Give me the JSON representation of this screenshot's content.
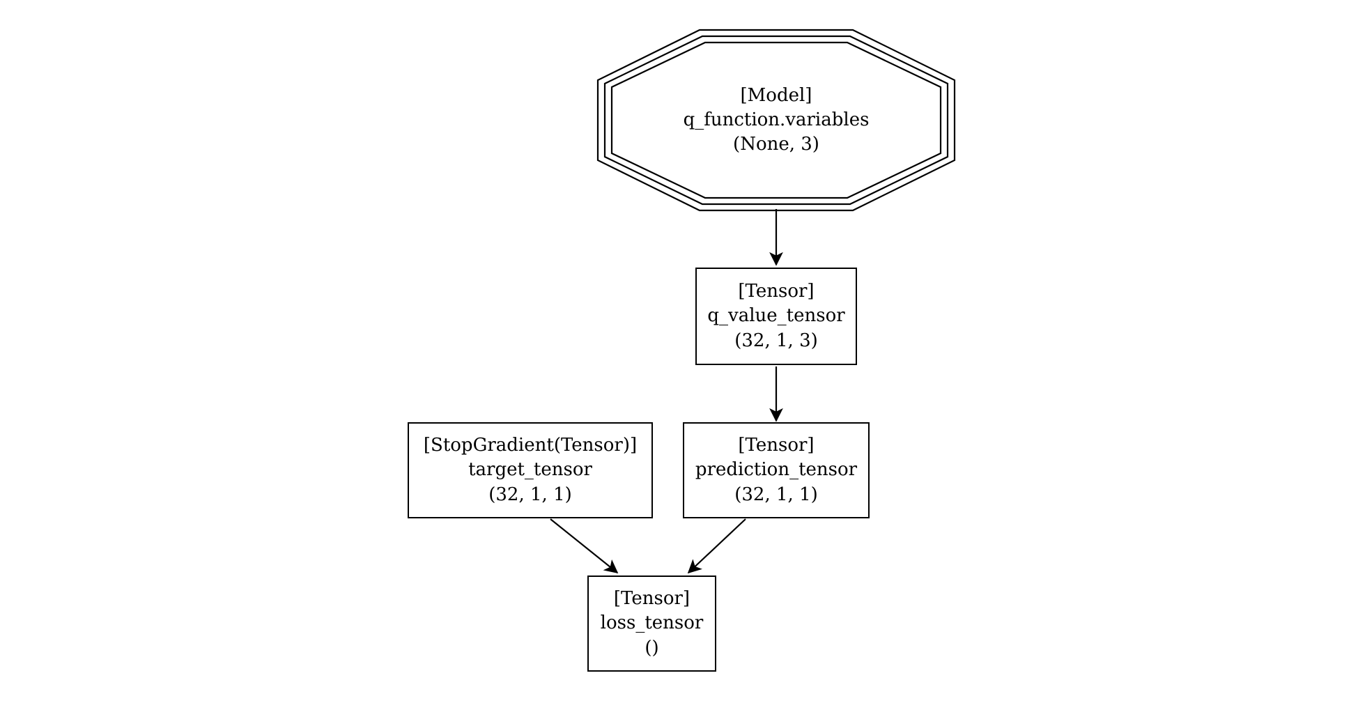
{
  "diagram": {
    "type": "computation-graph",
    "nodes": {
      "model": {
        "kind": "[Model]",
        "name": "q_function.variables",
        "shape": "(None, 3)",
        "node_shape": "tripleoctagon"
      },
      "q_value": {
        "kind": "[Tensor]",
        "name": "q_value_tensor",
        "shape": "(32, 1, 3)",
        "node_shape": "box"
      },
      "target": {
        "kind": "[StopGradient(Tensor)]",
        "name": "target_tensor",
        "shape": "(32, 1, 1)",
        "node_shape": "box"
      },
      "prediction": {
        "kind": "[Tensor]",
        "name": "prediction_tensor",
        "shape": "(32, 1, 1)",
        "node_shape": "box"
      },
      "loss": {
        "kind": "[Tensor]",
        "name": "loss_tensor",
        "shape": "()",
        "node_shape": "box"
      }
    },
    "edges": [
      {
        "from": "model",
        "to": "q_value"
      },
      {
        "from": "q_value",
        "to": "prediction"
      },
      {
        "from": "target",
        "to": "loss"
      },
      {
        "from": "prediction",
        "to": "loss"
      }
    ]
  }
}
